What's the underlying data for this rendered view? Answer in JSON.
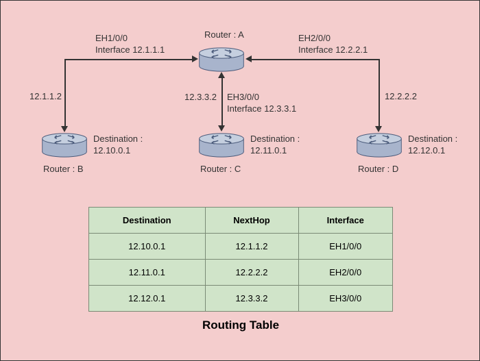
{
  "routers": {
    "a": {
      "name": "Router : A"
    },
    "b": {
      "name": "Router : B",
      "dest_label": "Destination :",
      "dest_value": "12.10.0.1"
    },
    "c": {
      "name": "Router : C",
      "dest_label": "Destination :",
      "dest_value": "12.11.0.1"
    },
    "d": {
      "name": "Router : D",
      "dest_label": "Destination :",
      "dest_value": "12.12.0.1"
    }
  },
  "links": {
    "ab": {
      "if_name": "EH1/0/0",
      "if_ip_label": "Interface 12.1.1.1",
      "hop": "12.1.1.2"
    },
    "ad": {
      "if_name": "EH2/0/0",
      "if_ip_label": "Interface 12.2.2.1",
      "hop": "12.2.2.2"
    },
    "ac": {
      "if_name": "EH3/0/0",
      "if_ip_label": "Interface 12.3.3.1",
      "hop": "12.3.3.2"
    }
  },
  "table": {
    "title": "Routing Table",
    "headers": {
      "dest": "Destination",
      "next": "NextHop",
      "iface": "Interface"
    },
    "rows": [
      {
        "dest": "12.10.0.1",
        "next": "12.1.1.2",
        "iface": "EH1/0/0"
      },
      {
        "dest": "12.11.0.1",
        "next": "12.2.2.2",
        "iface": "EH2/0/0"
      },
      {
        "dest": "12.12.0.1",
        "next": "12.3.3.2",
        "iface": "EH3/0/0"
      }
    ]
  }
}
